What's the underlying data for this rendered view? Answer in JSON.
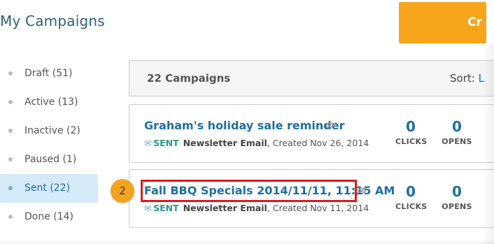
{
  "page": {
    "title": "My Campaigns"
  },
  "create_button": {
    "label": "Cr"
  },
  "sidebar": {
    "items": [
      {
        "label": "Draft (51)",
        "active": false
      },
      {
        "label": "Active (13)",
        "active": false
      },
      {
        "label": "Inactive (2)",
        "active": false
      },
      {
        "label": "Paused (1)",
        "active": false
      },
      {
        "label": "Sent (22)",
        "active": true
      },
      {
        "label": "Done (14)",
        "active": false
      }
    ]
  },
  "list_header": {
    "count_label": "22 Campaigns",
    "sort_label": "Sort:",
    "sort_value": "L"
  },
  "campaigns": [
    {
      "title": "Graham's holiday sale reminder",
      "status": "SENT",
      "type": "Newsletter Email",
      "created": ", Created Nov 26, 2014",
      "clicks": "0",
      "clicks_label": "CLICKS",
      "opens": "0",
      "opens_label": "OPENS"
    },
    {
      "title": "Fall BBQ Specials 2014/11/11, 11:15 AM",
      "status": "SENT",
      "type": "Newsletter Email",
      "created": ", Created Nov 11, 2014",
      "clicks": "0",
      "clicks_label": "CLICKS",
      "opens": "0",
      "opens_label": "OPENS"
    }
  ],
  "step_badge": {
    "number": "2"
  },
  "colors": {
    "accent_orange": "#f7a51b",
    "link_blue": "#1d6fa5",
    "sent_green": "#2b9a8e",
    "highlight_red": "#e0191f",
    "active_bg": "#d6e9f7"
  },
  "icons": {
    "link": "link-icon",
    "mail": "envelope-icon"
  }
}
